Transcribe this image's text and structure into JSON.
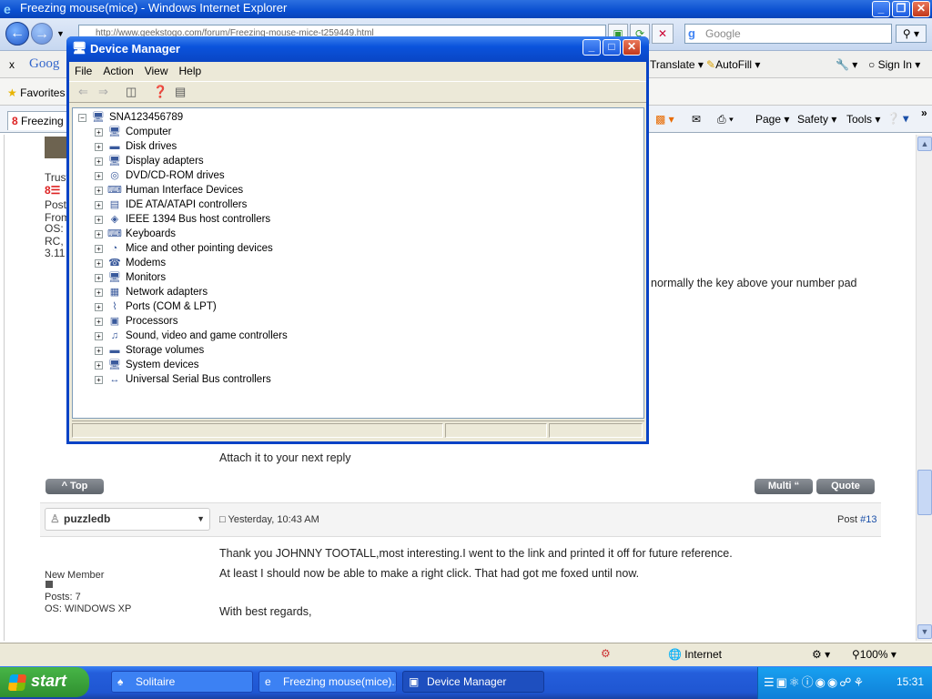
{
  "ie": {
    "title": "Freezing mouse(mice) - Windows Internet Explorer",
    "address": "http://www.geekstogo.com/forum/Freezing-mouse-mice-t259449.html",
    "search_placeholder": "Google",
    "google_toolbar": {
      "close": "x",
      "logo": "Goog",
      "translate": "Translate",
      "autofill": "AutoFill",
      "sign_in": "Sign In"
    },
    "favorites_label": "Favorites",
    "tab_label": "Freezing",
    "command_bar": {
      "page": "Page",
      "safety": "Safety",
      "tools": "Tools"
    },
    "status": {
      "zone": "Internet",
      "zoom": "100%"
    }
  },
  "page": {
    "left_col": {
      "trust": "Trust",
      "posts": "Posts",
      "from": "From",
      "os": "OS: X",
      "rc": "RC, M",
      "ver": "3.11"
    },
    "partial_text": "normally the key above your number pad",
    "attach_text": "Attach it to your next reply",
    "top_button": "^ Top",
    "multi_button": "Multi “",
    "quote_button": "Quote",
    "post": {
      "username": "puzzledb",
      "timestamp": "Yesterday, 10:43 AM",
      "post_label": "Post ",
      "post_number": "#13",
      "rank": "New Member",
      "posts": "Posts: 7",
      "os": "OS: WINDOWS XP",
      "lines": [
        "Thank you JOHNNY TOOTALL,most interesting.I went to the link and printed it off for future reference.",
        "At least I should now be able to make a right click. That had got me foxed until now.",
        "With best regards,"
      ]
    }
  },
  "device_manager": {
    "title": "Device Manager",
    "menu": [
      "File",
      "Action",
      "View",
      "Help"
    ],
    "root": "SNA123456789",
    "categories": [
      {
        "label": "Computer",
        "icon": "computer-icon",
        "glyph": "🖥"
      },
      {
        "label": "Disk drives",
        "icon": "disk-drive-icon",
        "glyph": "▬"
      },
      {
        "label": "Display adapters",
        "icon": "display-adapter-icon",
        "glyph": "🖥"
      },
      {
        "label": "DVD/CD-ROM drives",
        "icon": "dvd-drive-icon",
        "glyph": "◎"
      },
      {
        "label": "Human Interface Devices",
        "icon": "hid-icon",
        "glyph": "⌨"
      },
      {
        "label": "IDE ATA/ATAPI controllers",
        "icon": "ide-controller-icon",
        "glyph": "▤"
      },
      {
        "label": "IEEE 1394 Bus host controllers",
        "icon": "ieee1394-icon",
        "glyph": "◈"
      },
      {
        "label": "Keyboards",
        "icon": "keyboard-icon",
        "glyph": "⌨"
      },
      {
        "label": "Mice and other pointing devices",
        "icon": "mouse-icon",
        "glyph": "◔"
      },
      {
        "label": "Modems",
        "icon": "modem-icon",
        "glyph": "☎"
      },
      {
        "label": "Monitors",
        "icon": "monitor-icon",
        "glyph": "🖥"
      },
      {
        "label": "Network adapters",
        "icon": "network-adapter-icon",
        "glyph": "▦"
      },
      {
        "label": "Ports (COM & LPT)",
        "icon": "port-icon",
        "glyph": "⌇"
      },
      {
        "label": "Processors",
        "icon": "processor-icon",
        "glyph": "▣"
      },
      {
        "label": "Sound, video and game controllers",
        "icon": "sound-icon",
        "glyph": "♫"
      },
      {
        "label": "Storage volumes",
        "icon": "storage-volume-icon",
        "glyph": "▬"
      },
      {
        "label": "System devices",
        "icon": "system-device-icon",
        "glyph": "🖥"
      },
      {
        "label": "Universal Serial Bus controllers",
        "icon": "usb-icon",
        "glyph": "↔"
      }
    ]
  },
  "taskbar": {
    "start": "start",
    "tasks": [
      {
        "label": "Solitaire",
        "icon": "solitaire-icon",
        "active": false
      },
      {
        "label": "Freezing mouse(mice)...",
        "icon": "ie-icon",
        "active": false
      },
      {
        "label": "Device Manager",
        "icon": "device-manager-icon",
        "active": true
      }
    ],
    "clock": "15:31"
  },
  "colors": {
    "xp_blue": "#0a53dc",
    "taskbar_green": "#2f8f2f",
    "post_link": "#1a4fa8"
  }
}
